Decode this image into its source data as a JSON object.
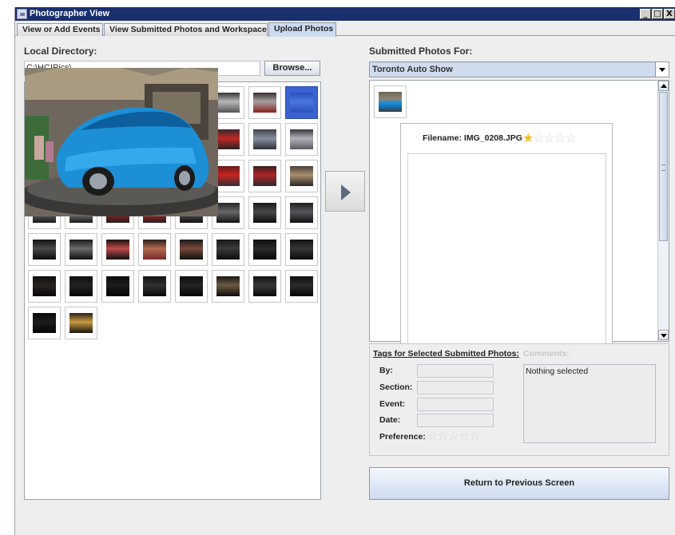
{
  "window": {
    "title": "Photographer View",
    "controls": {
      "minimize": "_",
      "maximize": "□",
      "close": "X"
    }
  },
  "tabs": [
    {
      "label": "View or Add Events",
      "active": false
    },
    {
      "label": "View Submitted Photos and Workspace",
      "active": false
    },
    {
      "label": "Upload Photos",
      "active": true
    }
  ],
  "local": {
    "section_label": "Local Directory:",
    "directory_value": "C:\\HCIPics\\",
    "browse_label": "Browse...",
    "thumbnail_count": 50,
    "selected_thumbnail": 8
  },
  "submitted": {
    "section_label": "Submitted Photos For:",
    "event_selected": "Toronto Auto Show",
    "thumbnail_count": 1
  },
  "preview": {
    "filename_label": "Filename: IMG_0208.JPG",
    "rating": 1,
    "rating_max": 5
  },
  "tags": {
    "title": "Tags for Selected Submitted Photos:",
    "comments_title": "Comments:",
    "by_label": "By:",
    "section_label": "Section:",
    "event_label": "Event:",
    "date_label": "Date:",
    "preference_label": "Preference:",
    "preference_rating": 0,
    "comments_value": "Nothing selected"
  },
  "return_label": "Return to Previous Screen",
  "colors": {
    "title_bar": "#1a2f6e",
    "active_tab": "#ccdcf0",
    "selected_thumb": "#3a62d0",
    "car_blue": "#1c8fd6",
    "star_on": "#f2c21b"
  },
  "icons": {
    "move": "right-arrow-icon",
    "star": "star-icon",
    "dropdown": "chevron-down-icon"
  }
}
